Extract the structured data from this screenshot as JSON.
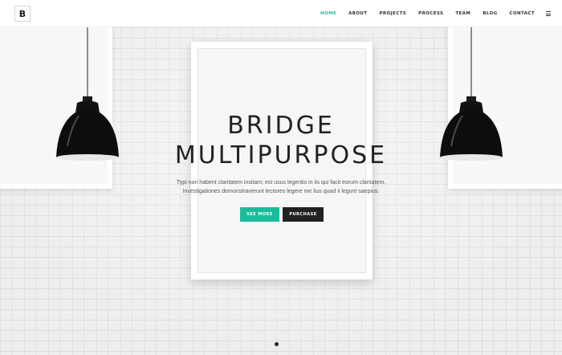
{
  "header": {
    "logo": "B",
    "nav": [
      {
        "label": "HOME",
        "active": true
      },
      {
        "label": "ABOUT",
        "active": false
      },
      {
        "label": "PROJECTS",
        "active": false
      },
      {
        "label": "PROCESS",
        "active": false
      },
      {
        "label": "TEAM",
        "active": false
      },
      {
        "label": "BLOG",
        "active": false
      },
      {
        "label": "CONTACT",
        "active": false
      }
    ],
    "menu_icon": "hamburger-icon"
  },
  "hero": {
    "title_line1": "BRIDGE",
    "title_line2": "MULTIPURPOSE",
    "text_line1": "Typi non habent claritatem insitam; est usus legentis in iis qui facit eorum claritatem.",
    "text_line2": "Investigationes demonstraverunt lectores legere me lius quod ii legunt saepius.",
    "button_primary": "SEE MORE",
    "button_secondary": "PURCHASE"
  },
  "slider": {
    "dots": 1,
    "active_index": 0
  },
  "colors": {
    "accent": "#1abc9c",
    "dark_button": "#222222",
    "text": "#222222"
  }
}
